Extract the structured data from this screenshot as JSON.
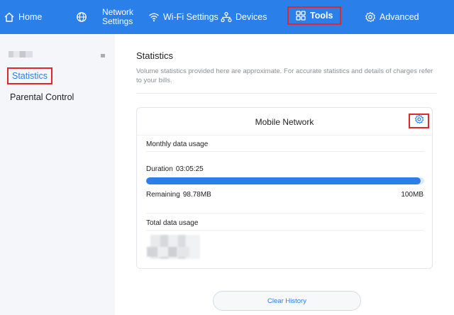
{
  "nav": {
    "home": "Home",
    "network_settings": "Network Settings",
    "wifi_settings": "Wi-Fi Settings",
    "devices": "Devices",
    "tools": "Tools",
    "advanced": "Advanced",
    "active": "tools"
  },
  "sidebar": {
    "items": [
      {
        "label": "Statistics",
        "active": true
      },
      {
        "label": "Parental Control",
        "active": false
      }
    ]
  },
  "main": {
    "title": "Statistics",
    "description": "Volume statistics provided here are approximate. For accurate statistics and details of charges refer to your bills."
  },
  "card": {
    "title": "Mobile Network",
    "monthly_label": "Monthly data usage",
    "duration_label": "Duration",
    "duration_value": "03:05:25",
    "remaining_label": "Remaining",
    "remaining_value": "98.78MB",
    "total_value": "100MB",
    "progress_fraction": 0.988,
    "total_usage_label": "Total data usage"
  },
  "actions": {
    "clear_history": "Clear History"
  },
  "colors": {
    "accent": "#2a7fe9",
    "highlight": "#e0272e"
  }
}
